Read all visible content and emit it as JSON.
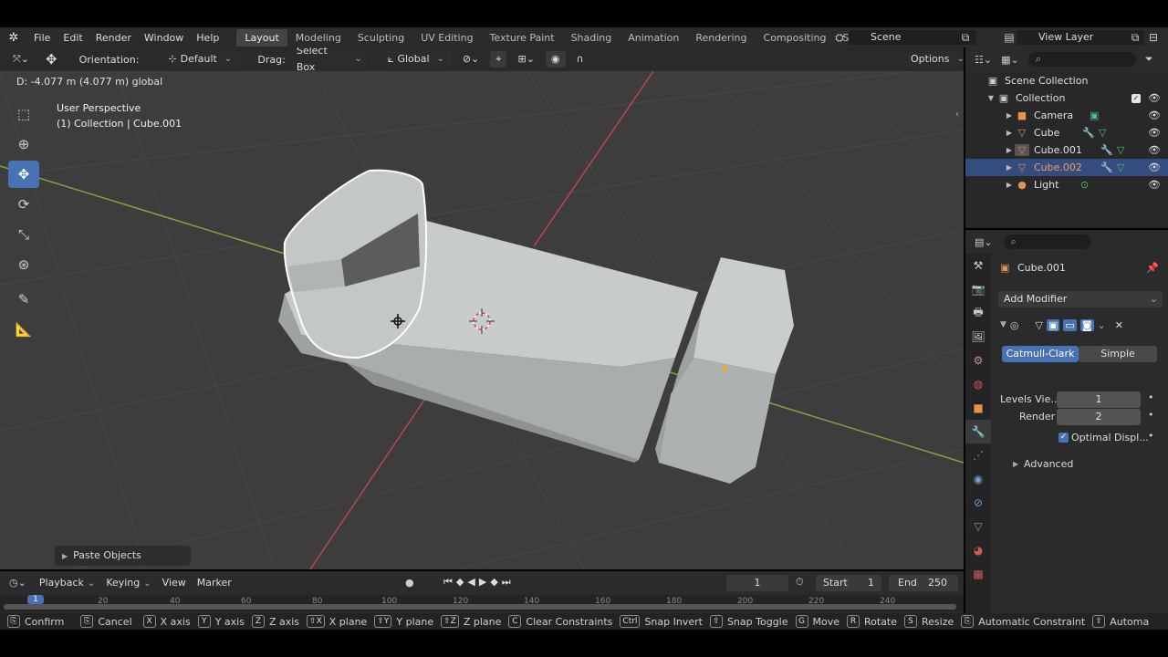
{
  "menubar": {
    "logo_icon": "blender-logo-icon",
    "menus": [
      "File",
      "Edit",
      "Render",
      "Window",
      "Help"
    ],
    "tabs": [
      "Layout",
      "Modeling",
      "Sculpting",
      "UV Editing",
      "Texture Paint",
      "Shading",
      "Animation",
      "Rendering",
      "Compositing",
      "Scripting"
    ],
    "active_tab": "Layout",
    "add_tab": "+",
    "scene_name": "Scene",
    "view_layer": "View Layer"
  },
  "viewport": {
    "header": {
      "orientation_label": "Orientation:",
      "orientation_value": "Default",
      "drag_label": "Drag:",
      "drag_value": "Select Box",
      "transform_space": "Global",
      "options_label": "Options"
    },
    "status_line": "D: -4.077 m (4.077 m) global",
    "perspective": "User Perspective",
    "collection_info": "(1) Collection | Cube.001",
    "tools": [
      "select-box-tool",
      "cursor-tool",
      "move-tool",
      "rotate-tool",
      "scale-tool",
      "transform-tool",
      "annotate-tool",
      "measure-tool"
    ],
    "active_tool": "move-tool",
    "last_operator": "Paste Objects"
  },
  "outliner": {
    "rows": [
      {
        "label": "Scene Collection",
        "icon": "scene-collection-icon",
        "selected": false
      },
      {
        "label": "Collection",
        "icon": "collection-icon",
        "selected": false
      },
      {
        "label": "Camera",
        "icon": "camera-icon",
        "selected": false
      },
      {
        "label": "Cube",
        "icon": "mesh-icon",
        "selected": false
      },
      {
        "label": "Cube.001",
        "icon": "mesh-icon",
        "selected": false
      },
      {
        "label": "Cube.002",
        "icon": "mesh-icon",
        "selected": true
      },
      {
        "label": "Light",
        "icon": "light-icon",
        "selected": false
      }
    ],
    "selected_color": "#f0a050"
  },
  "properties": {
    "object_name": "Cube.001",
    "add_modifier": "Add Modifier",
    "subdiv_types": [
      "Catmull-Clark",
      "Simple"
    ],
    "active_subdiv": "Catmull-Clark",
    "levels_viewport_label": "Levels Vie...",
    "levels_viewport_value": "1",
    "render_label": "Render",
    "render_value": "2",
    "optimal_display_label": "Optimal Displ...",
    "optimal_display_checked": true,
    "advanced_label": "Advanced"
  },
  "timeline": {
    "playback": "Playback",
    "keying": "Keying",
    "view": "View",
    "marker": "Marker",
    "current_frame": "1",
    "start_label": "Start",
    "start_value": "1",
    "end_label": "End",
    "end_value": "250",
    "ruler_ticks": [
      "1",
      "20",
      "40",
      "60",
      "80",
      "100",
      "120",
      "140",
      "160",
      "180",
      "200",
      "220",
      "240"
    ]
  },
  "statusbar": {
    "items": [
      {
        "key": "⎘",
        "label": "Confirm"
      },
      {
        "key": "⎘",
        "label": "Cancel"
      },
      {
        "key": "X",
        "label": "X axis"
      },
      {
        "key": "Y",
        "label": "Y axis"
      },
      {
        "key": "Z",
        "label": "Z axis"
      },
      {
        "key": "⇧X",
        "label": "X plane"
      },
      {
        "key": "⇧Y",
        "label": "Y plane"
      },
      {
        "key": "⇧Z",
        "label": "Z plane"
      },
      {
        "key": "C",
        "label": "Clear Constraints"
      },
      {
        "key": "Ctrl",
        "label": "Snap Invert"
      },
      {
        "key": "⇧",
        "label": "Snap Toggle"
      },
      {
        "key": "G",
        "label": "Move"
      },
      {
        "key": "R",
        "label": "Rotate"
      },
      {
        "key": "S",
        "label": "Resize"
      },
      {
        "key": "⎘",
        "label": "Automatic Constraint"
      },
      {
        "key": "⇧",
        "label": "Automa"
      }
    ]
  },
  "colors": {
    "accent": "#4772b3",
    "axis_x": "#c2414d",
    "axis_y": "#7ea63c",
    "selection_outline": "#ffffff",
    "mesh": "#b9bebd"
  }
}
